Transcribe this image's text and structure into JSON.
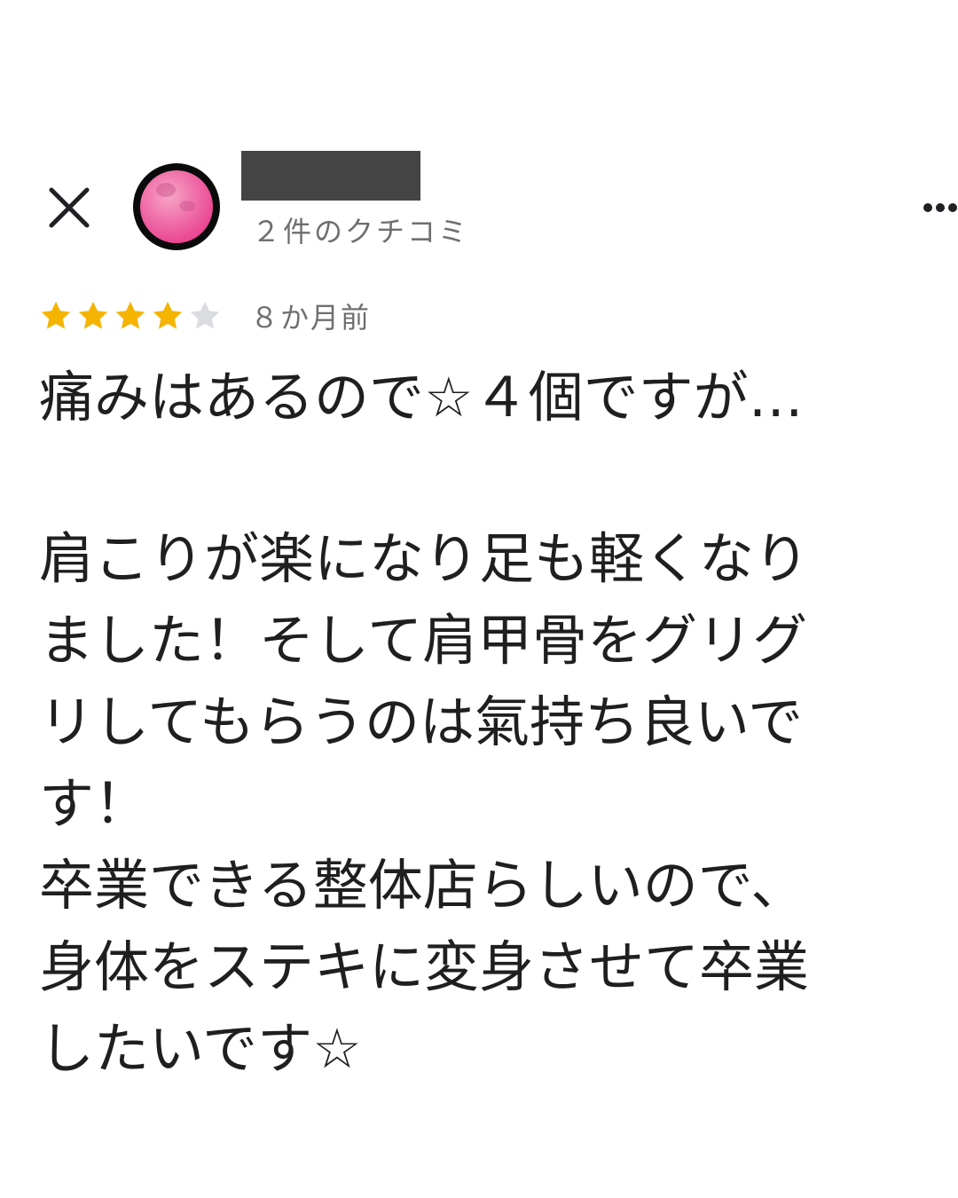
{
  "header": {
    "close_icon": "close-icon",
    "more_icon": "more-horizontal-icon",
    "avatar_icon": "pink-moon-avatar",
    "review_count": "２件のクチコミ"
  },
  "rating": {
    "stars": 4,
    "max_stars": 5,
    "star_color": "#f4b400",
    "empty_star_color": "#dadce0",
    "time_ago": "８か月前"
  },
  "review": {
    "title": "痛みはあるので☆４個ですが…",
    "lines": [
      "肩こりが楽になり足も軽くなり",
      "ました！そして肩甲骨をグリグ",
      "リしてもらうのは氣持ち良いで",
      "す！",
      "卒業できる整体店らしいので、",
      "身体をステキに変身させて卒業",
      "したいです☆"
    ]
  }
}
